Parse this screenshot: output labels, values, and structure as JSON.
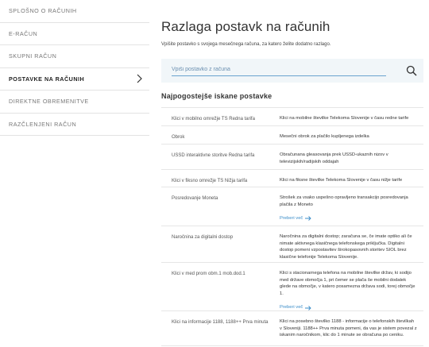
{
  "sidebar": {
    "items": [
      {
        "label": "SPLOŠNO O RAČUNIH",
        "active": false
      },
      {
        "label": "E-RAČUN",
        "active": false
      },
      {
        "label": "SKUPNI RAČUN",
        "active": false
      },
      {
        "label": "POSTAVKE NA RAČUNIH",
        "active": true
      },
      {
        "label": "DIREKTNE OBREMENITVE",
        "active": false
      },
      {
        "label": "RAZČLENJENI RAČUN",
        "active": false
      }
    ]
  },
  "main": {
    "title": "Razlaga postavk na računih",
    "subtitle": "Vpišite postavko s svojega mesečnega računa, za katero želite dodatno razlago.",
    "search": {
      "placeholder": "Vpiši postavko z računa",
      "value": ""
    },
    "section_title": "Najpogostejše iskane postavke",
    "more_label": "Preberi več",
    "rows": [
      {
        "item": "Klici v mobilno omrežje TS Redna tarifa",
        "desc": "Klici na mobilne številke Telekoma Slovenije v času redne tarife"
      },
      {
        "item": "Obrok",
        "desc": "Mesečni obrok za plačilo kupljenega izdelka"
      },
      {
        "item": "USSD interaktivne storitve Redna tarifa",
        "desc": "Obračunana gleasovanja prek USSD-ukaznih nizov v televizijskih/radijskih oddajah"
      },
      {
        "item": "Klici v fiksno omrežje TS Nižja tarifa",
        "desc": "Klici na fiksne številke Telekoma Slovenije v času nižje tarife"
      },
      {
        "item": "Posredovanje Moneta",
        "desc": "Strošek za vsako uspešno opravljeno transakcijo posredovanja plačila z Moneto"
      },
      {
        "item": "Naročnina za digitalni dostop",
        "desc": "Naročnina za digitalni dostop; zaračuna se, če imate optiko ali če nimate aktivnega klasičnega telefonskega priključka. Digitalni dostop pomeni vzpostavitev širokopasovnih storitev SIOL brez klasične telefonije Telekoma Slovenije."
      },
      {
        "item": "Klici v med prom obm.1 mob.dod.1",
        "desc": "Klici s stacionarnega telefona na mobilne številke držav, ki sodijo med države območja 1, pri čemer se plača še mobilni dodatek glede na območje, v katero posamezna država sodi, torej območje 1."
      },
      {
        "item": "Klici na informacije 1188, 1188++ Prva minuta",
        "desc": "Klici na posebno številko 1188 - informacije o telefonskih številkah v Sloveniji. 1188++ Prva minuta pomeni, da vas je sistem povezal z iskanim naročnikom, klic do 1 minute se obračuna po ceniku."
      }
    ]
  },
  "colors": {
    "accent": "#3a8cc8",
    "search_bg": "#f1f6f9",
    "border": "#e3e3e3"
  }
}
